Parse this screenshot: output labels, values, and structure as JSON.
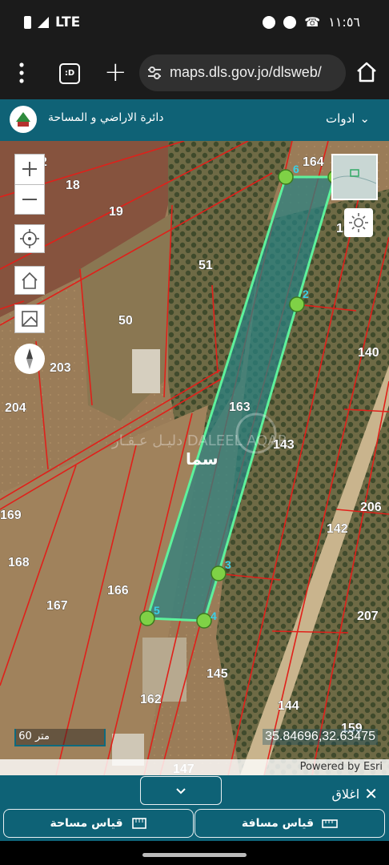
{
  "status_bar": {
    "network": "LTE",
    "time": "١١:٥٦"
  },
  "browser": {
    "url": "maps.dls.gov.jo/dlsweb/",
    "tabs_icon_label": ":D"
  },
  "app_header": {
    "title": "دائرة الاراضي و المساحة",
    "tools_label": "ادوات"
  },
  "map": {
    "scale_label": "60 متر",
    "coordinates": "35.84696,32.63475",
    "attribution": "Powered by Esri",
    "watermark": "دليـل عـقـار DALEEL AQAR",
    "annotation": "سما",
    "parcel_labels": [
      "164",
      "18",
      "19",
      "51",
      "50",
      "203",
      "204",
      "163",
      "143",
      "140",
      "169",
      "168",
      "167",
      "166",
      "142",
      "206",
      "207",
      "145",
      "144",
      "162",
      "159",
      "147",
      "1",
      "2"
    ],
    "vertex_labels": [
      "6",
      "2",
      "3",
      "4",
      "5"
    ]
  },
  "bottom_panel": {
    "close_label": "اغلاق",
    "measure_distance_label": "قياس مسافة",
    "measure_area_label": "قياس مساحة"
  }
}
